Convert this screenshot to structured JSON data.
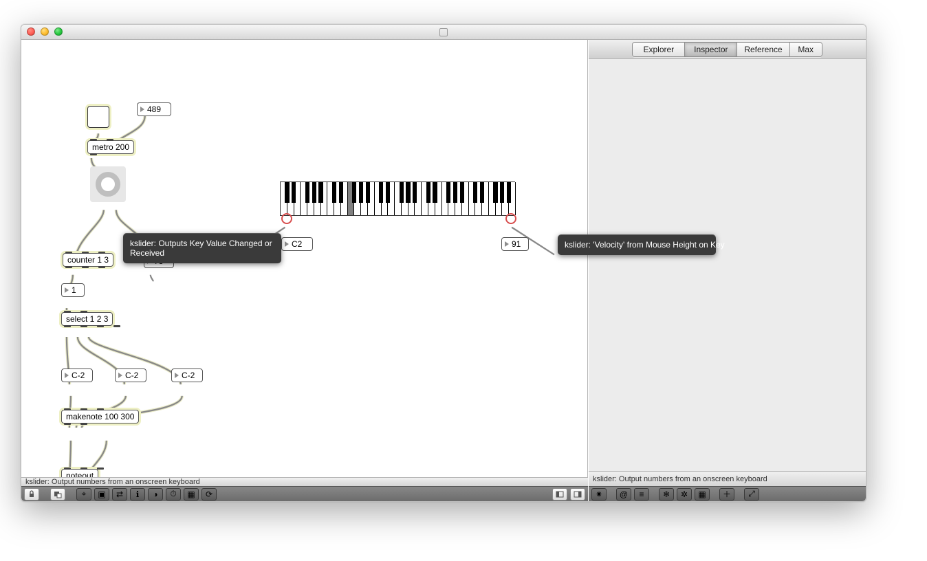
{
  "window": {
    "title": ""
  },
  "tabs": {
    "explorer": "Explorer",
    "inspector": "Inspector",
    "reference": "Reference",
    "max": "Max",
    "selected": "inspector"
  },
  "status_left": "kslider: Output numbers from an onscreen keyboard",
  "status_right": "kslider: Output numbers from an onscreen keyboard",
  "tooltips": {
    "left": "kslider: Outputs Key Value Changed or Received",
    "right": "kslider: 'Velocity' from Mouse Height on Key"
  },
  "objects": {
    "metro": {
      "text": "metro 200"
    },
    "tempo_num": {
      "value": "489"
    },
    "rand_num": {
      "value": "78"
    },
    "counter": {
      "text": "counter 1 3"
    },
    "one_msg": {
      "value": "1"
    },
    "select": {
      "text": "select 1 2 3"
    },
    "noteA": {
      "value": "C-2"
    },
    "noteB": {
      "value": "C-2"
    },
    "noteC": {
      "value": "C-2"
    },
    "makenote": {
      "text": "makenote 100 300"
    },
    "noteout": {
      "text": "noteout"
    },
    "kslider_out_note": {
      "value": "C2"
    },
    "kslider_out_vel": {
      "value": "91"
    }
  },
  "kslider": {
    "range_note": "five octaves; selected white key is the 4th key of the 2nd octave (F-ish visually highlighted)"
  },
  "toolbar_icons_left": [
    "lock",
    "new-object",
    "snap",
    "presentation",
    "route",
    "info",
    "color",
    "timeline",
    "grid",
    "schedule"
  ],
  "toolbar_icons_right_left_panel": [
    "sidebar-left",
    "sidebar-right"
  ],
  "toolbar_icons_right_panel": [
    "sun",
    "at",
    "list",
    "snow",
    "gear",
    "panel",
    "add",
    "expand"
  ]
}
